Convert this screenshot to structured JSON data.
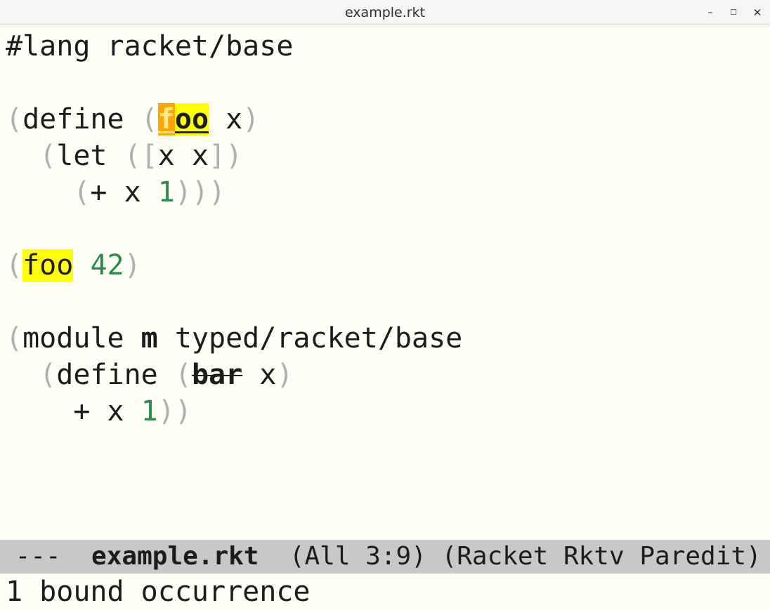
{
  "window": {
    "title": "example.rkt",
    "minimize_glyph": "–",
    "maximize_glyph": "☐",
    "close_glyph": "✕"
  },
  "code": {
    "line1": {
      "text": "#lang racket/base"
    },
    "line3": {
      "open_paren": "(",
      "define_kw": "define ",
      "open_paren2": "(",
      "foo_first_char": "f",
      "foo_rest": "oo",
      "space_x": " x",
      "close_paren": ")"
    },
    "line4": {
      "indent": "  ",
      "open_paren": "(",
      "let_kw": "let ",
      "open_paren2": "(",
      "open_bracket": "[",
      "binding": "x x",
      "close_bracket": "]",
      "close_paren": ")"
    },
    "line5": {
      "indent": "    ",
      "open_paren": "(",
      "expr": "+ x ",
      "number": "1",
      "close_parens": ")))"
    },
    "line7": {
      "open_paren": "(",
      "foo_call": "foo",
      "space": " ",
      "number": "42",
      "close_paren": ")"
    },
    "line9": {
      "open_paren": "(",
      "module_kw": "module ",
      "module_name": "m",
      "lang": " typed/racket/base"
    },
    "line10": {
      "indent": "  ",
      "open_paren": "(",
      "define_kw": "define ",
      "open_paren2": "(",
      "bar": "bar",
      "space_x": " x",
      "close_paren": ")"
    },
    "line11": {
      "indent": "    ",
      "expr": "+ x ",
      "number": "1",
      "close_parens": "))"
    }
  },
  "modeline": {
    "status": " ---  ",
    "buffer_name": "example.rkt",
    "position": "  (All 3:9) ",
    "modes": "(Racket Rktv Paredit)"
  },
  "minibuffer": {
    "message": "1 bound occurrence"
  },
  "colors": {
    "background": "#fffef5",
    "paren": "#b0b0b0",
    "number": "#2d8a4f",
    "highlight_yellow": "#ffff00",
    "highlight_orange": "#ffa500",
    "modeline_bg": "#c8c8c8"
  }
}
